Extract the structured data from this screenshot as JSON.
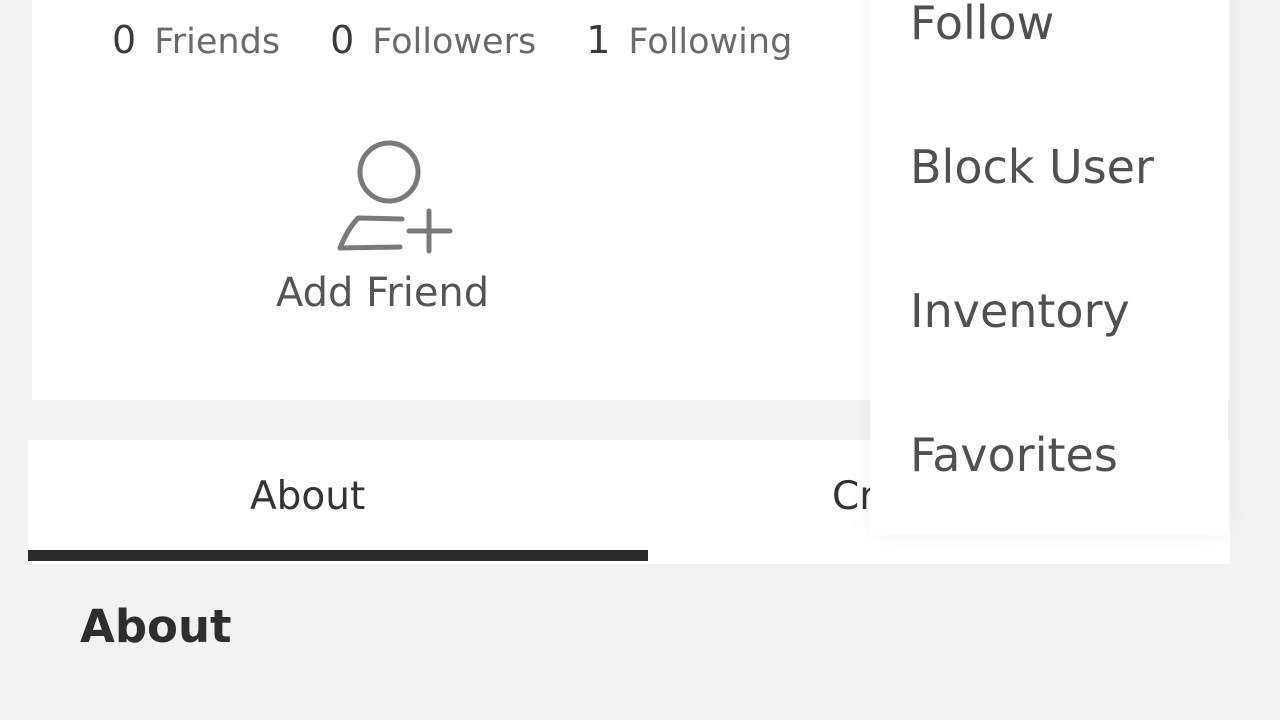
{
  "profile": {
    "stats": [
      {
        "count": "0",
        "label": "Friends"
      },
      {
        "count": "0",
        "label": "Followers"
      },
      {
        "count": "1",
        "label": "Following"
      }
    ],
    "add_friend_label": "Add Friend",
    "add_friend_icon": "add-person-icon"
  },
  "tabs": [
    {
      "label": "About",
      "active": true
    },
    {
      "label": "Creations",
      "visible_text": "Cr",
      "active": false
    }
  ],
  "section": {
    "title": "About"
  },
  "menu": {
    "items": [
      {
        "label": "Follow"
      },
      {
        "label": "Block User"
      },
      {
        "label": "Inventory"
      },
      {
        "label": "Favorites"
      }
    ]
  },
  "colors": {
    "background": "#f2f2f3",
    "card": "#ffffff",
    "text_primary": "#333333",
    "text_secondary": "#6a6a6a",
    "tab_indicator": "#2b2b2b"
  }
}
